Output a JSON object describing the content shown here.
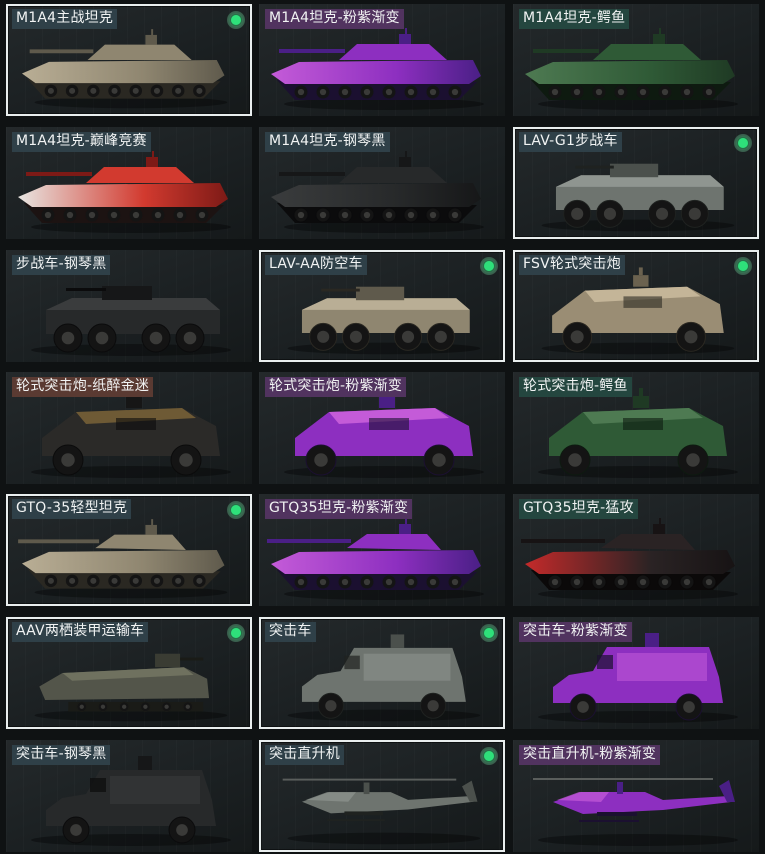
{
  "colors": {
    "tag_default": "#2f4048",
    "tag_purple": "#51335f",
    "tag_teal": "#24463f",
    "tag_rose": "#5a3a32",
    "owned_dot": "#2ee07a",
    "selected_border": "#e9eeee"
  },
  "items": [
    {
      "label": "M1A4主战坦克",
      "owned": true,
      "selected": true,
      "tag": "tag_default",
      "kind": "tank",
      "skin": "desert"
    },
    {
      "label": "M1A4坦克-粉紫渐变",
      "owned": false,
      "selected": false,
      "tag": "tag_purple",
      "kind": "tank",
      "skin": "purple"
    },
    {
      "label": "M1A4坦克-鳄鱼",
      "owned": false,
      "selected": false,
      "tag": "tag_teal",
      "kind": "tank",
      "skin": "croc"
    },
    {
      "label": "M1A4坦克-巅峰竞赛",
      "owned": false,
      "selected": false,
      "tag": "tag_default",
      "kind": "tank",
      "skin": "race"
    },
    {
      "label": "M1A4坦克-钢琴黑",
      "owned": false,
      "selected": false,
      "tag": "tag_default",
      "kind": "tank",
      "skin": "black"
    },
    {
      "label": "LAV-G1步战车",
      "owned": true,
      "selected": true,
      "tag": "tag_default",
      "kind": "apc",
      "skin": "grey"
    },
    {
      "label": "步战车-钢琴黑",
      "owned": false,
      "selected": false,
      "tag": "tag_default",
      "kind": "apc",
      "skin": "black"
    },
    {
      "label": "LAV-AA防空车",
      "owned": true,
      "selected": true,
      "tag": "tag_default",
      "kind": "apc",
      "skin": "desert"
    },
    {
      "label": "FSV轮式突击炮",
      "owned": true,
      "selected": true,
      "tag": "tag_default",
      "kind": "armoredcar",
      "skin": "tan"
    },
    {
      "label": "轮式突击炮-纸醉金迷",
      "owned": false,
      "selected": false,
      "tag": "tag_rose",
      "kind": "armoredcar",
      "skin": "gold"
    },
    {
      "label": "轮式突击炮-粉紫渐变",
      "owned": false,
      "selected": false,
      "tag": "tag_purple",
      "kind": "armoredcar",
      "skin": "purple"
    },
    {
      "label": "轮式突击炮-鳄鱼",
      "owned": false,
      "selected": false,
      "tag": "tag_teal",
      "kind": "armoredcar",
      "skin": "croc"
    },
    {
      "label": "GTQ-35轻型坦克",
      "owned": true,
      "selected": true,
      "tag": "tag_default",
      "kind": "lighttank",
      "skin": "desert"
    },
    {
      "label": "GTQ35坦克-粉紫渐变",
      "owned": false,
      "selected": false,
      "tag": "tag_purple",
      "kind": "lighttank",
      "skin": "purple"
    },
    {
      "label": "GTQ35坦克-猛攻",
      "owned": false,
      "selected": false,
      "tag": "tag_teal",
      "kind": "lighttank",
      "skin": "red"
    },
    {
      "label": "AAV两栖装甲运输车",
      "owned": true,
      "selected": true,
      "tag": "tag_default",
      "kind": "aav",
      "skin": "olive"
    },
    {
      "label": "突击车",
      "owned": true,
      "selected": true,
      "tag": "tag_default",
      "kind": "mrap",
      "skin": "grey"
    },
    {
      "label": "突击车-粉紫渐变",
      "owned": false,
      "selected": false,
      "tag": "tag_purple",
      "kind": "mrap",
      "skin": "purple"
    },
    {
      "label": "突击车-钢琴黑",
      "owned": false,
      "selected": false,
      "tag": "tag_default",
      "kind": "mrap",
      "skin": "black"
    },
    {
      "label": "突击直升机",
      "owned": true,
      "selected": true,
      "tag": "tag_default",
      "kind": "heli",
      "skin": "grey"
    },
    {
      "label": "突击直升机-粉紫渐变",
      "owned": false,
      "selected": false,
      "tag": "tag_purple",
      "kind": "heli",
      "skin": "purple"
    }
  ]
}
